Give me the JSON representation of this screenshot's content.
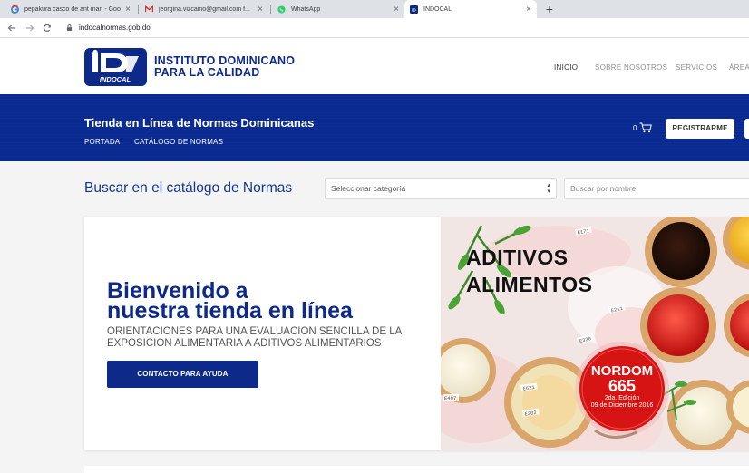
{
  "browser": {
    "tabs": [
      {
        "label": "pepakura casco de ant man - Goo",
        "favicon": "google-icon"
      },
      {
        "label": "jeorgina.vizcaino@gmail.com f...",
        "favicon": "gmail-icon"
      },
      {
        "label": "WhatsApp",
        "favicon": "whatsapp-icon"
      },
      {
        "label": "INDOCAL",
        "favicon": "indocal-icon",
        "active": true
      }
    ],
    "url": "indocalnormas.gob.do"
  },
  "site": {
    "logo_text": "INDOCAL",
    "name_line1": "INSTITUTO DOMINICANO",
    "name_line2": "PARA LA CALIDAD",
    "nav": [
      "INICIO",
      "SOBRE NOSOTROS",
      "SERVICIOS",
      "ÁREAS"
    ]
  },
  "store": {
    "title": "Tienda en Línea de Normas Dominicanas",
    "links": [
      "PORTADA",
      "CATÁLOGO DE NORMAS"
    ],
    "cart_count": "0",
    "register_label": "REGISTRARME"
  },
  "search": {
    "heading": "Buscar en el catálogo de Normas",
    "category_value": "Seleccionar categoría",
    "name_placeholder": "Buscar por nombre"
  },
  "hero": {
    "title_line1": "Bienvenido a",
    "title_line2": "nuestra tienda en línea",
    "subtitle": "ORIENTACIONES PARA UNA EVALUACION SENCILLA DE LA EXPOSICION ALIMENTARIA A ADITIVOS ALIMENTARIOS",
    "button_label": "CONTACTO PARA AYUDA",
    "image": {
      "text_line1": "ADITIVOS",
      "text_line2": "ALIMENTOS",
      "seal_line1": "NORDOM",
      "seal_line2": "665",
      "seal_edition": "2da. Edición",
      "seal_date": "09 de Diciembre 2016",
      "bowl_labels": [
        "E171",
        "E621",
        "E407",
        "E330",
        "E202",
        "E211"
      ]
    }
  },
  "colors": {
    "brand_blue": "#0d2a8a",
    "band_blue": "#0a2a8f",
    "heading_blue": "#12358f",
    "seal_red": "#d61414"
  }
}
